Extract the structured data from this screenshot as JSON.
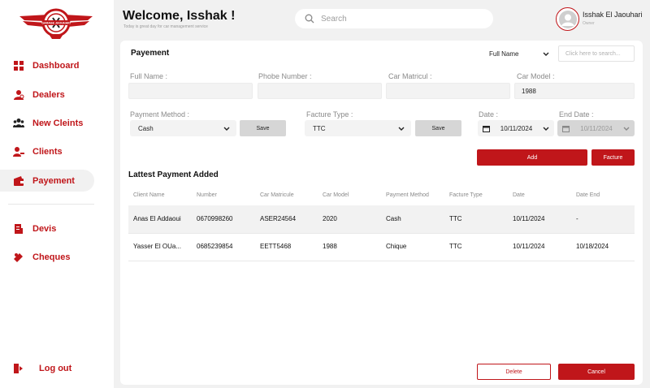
{
  "app": {
    "logo_text": "GARAGE JAOUHARI",
    "accent": "#c0161a"
  },
  "sidebar": {
    "items": [
      {
        "label": "Dashboard",
        "icon": "dashboard-grid-icon"
      },
      {
        "label": "Dealers",
        "icon": "dealers-icon"
      },
      {
        "label": "New Cleints",
        "icon": "group-users-icon"
      },
      {
        "label": "Clients",
        "icon": "clients-icon"
      },
      {
        "label": "Payement",
        "icon": "wallet-icon",
        "active": true
      },
      {
        "label": "Devis",
        "icon": "document-icon"
      },
      {
        "label": "Cheques",
        "icon": "cheque-icon"
      }
    ],
    "logout": "Log out"
  },
  "header": {
    "welcome": "Welcome, Isshak !",
    "subtitle": "Today is great day for car management service",
    "search_placeholder": "Search",
    "user_name": "Isshak El Jaouhari",
    "user_role": "Owner"
  },
  "payment": {
    "title": "Payement",
    "filter_select": "Full Name",
    "filter_search_placeholder": "Click here to search...",
    "labels": {
      "full_name": "Full Name :",
      "phone": "Phobe Number :",
      "matricul": "Car Matricul :",
      "model": "Car Model :",
      "method": "Payment Method :",
      "facture_type": "Facture Type :",
      "date": "Date :",
      "end_date": "End Date :"
    },
    "values": {
      "full_name": "",
      "phone": "",
      "matricul": "",
      "model": "1988",
      "method": "Cash",
      "facture_type": "TTC",
      "date": "10/11/2024",
      "end_date": "10/11/2024"
    },
    "buttons": {
      "save_method": "Save",
      "save_facture": "Save",
      "add": "Add",
      "facture": "Facture",
      "delete": "Delete",
      "cancel": "Cancel"
    }
  },
  "table": {
    "title": "Lattest Payment Added",
    "headers": [
      "Client Name",
      "Number",
      "Car Matricule",
      "Car Model",
      "Payment Method",
      "Facture Type",
      "Date",
      "Date End"
    ],
    "rows": [
      [
        "Anas El Addaoui",
        "0670998260",
        "ASER24564",
        "2020",
        "Cash",
        "TTC",
        "10/11/2024",
        "-"
      ],
      [
        "Yasser El OUa...",
        "0685239854",
        "EETT5468",
        "1988",
        "Chique",
        "TTC",
        "10/11/2024",
        "10/18/2024"
      ]
    ]
  }
}
